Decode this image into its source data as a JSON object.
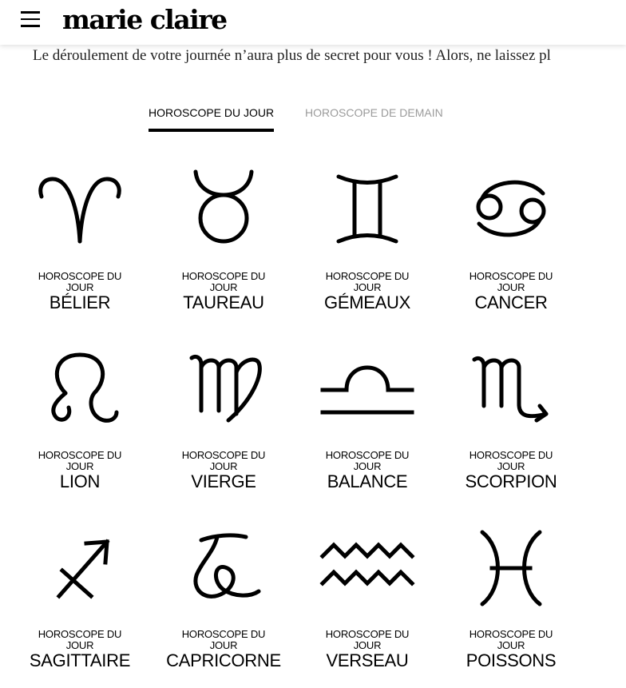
{
  "header": {
    "menu_icon": "hamburger-menu-icon",
    "logo_text": "marie claire"
  },
  "intro_text": "Le déroulement de votre journée n’aura plus de secret pour vous ! Alors, ne laissez pl",
  "tabs": [
    {
      "label": "HOROSCOPE DU JOUR",
      "active": true
    },
    {
      "label": "HOROSCOPE DE DEMAIN",
      "active": false
    }
  ],
  "signs": [
    {
      "kicker": "HOROSCOPE DU JOUR",
      "name": "BÉLIER",
      "icon": "aries-icon"
    },
    {
      "kicker": "HOROSCOPE DU JOUR",
      "name": "TAUREAU",
      "icon": "taurus-icon"
    },
    {
      "kicker": "HOROSCOPE DU JOUR",
      "name": "GÉMEAUX",
      "icon": "gemini-icon"
    },
    {
      "kicker": "HOROSCOPE DU JOUR",
      "name": "CANCER",
      "icon": "cancer-icon"
    },
    {
      "kicker": "HOROSCOPE DU JOUR",
      "name": "LION",
      "icon": "leo-icon"
    },
    {
      "kicker": "HOROSCOPE DU JOUR",
      "name": "VIERGE",
      "icon": "virgo-icon"
    },
    {
      "kicker": "HOROSCOPE DU JOUR",
      "name": "BALANCE",
      "icon": "libra-icon"
    },
    {
      "kicker": "HOROSCOPE DU JOUR",
      "name": "SCORPION",
      "icon": "scorpio-icon"
    },
    {
      "kicker": "HOROSCOPE DU JOUR",
      "name": "SAGITTAIRE",
      "icon": "sagittarius-icon"
    },
    {
      "kicker": "HOROSCOPE DU JOUR",
      "name": "CAPRICORNE",
      "icon": "capricorn-icon"
    },
    {
      "kicker": "HOROSCOPE DU JOUR",
      "name": "VERSEAU",
      "icon": "aquarius-icon"
    },
    {
      "kicker": "HOROSCOPE DU JOUR",
      "name": "POISSONS",
      "icon": "pisces-icon"
    }
  ]
}
